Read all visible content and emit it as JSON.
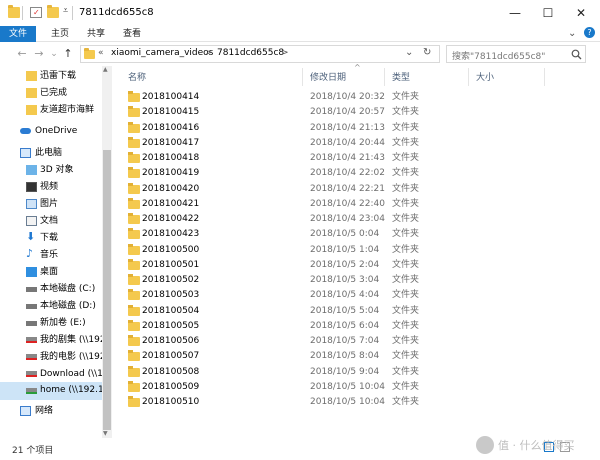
{
  "window": {
    "title": "7811dcd655c8",
    "controls": {
      "minimize": "—",
      "maximize": "☐",
      "close": "✕"
    }
  },
  "ribbon": {
    "tabs": [
      "文件",
      "主页",
      "共享",
      "查看"
    ]
  },
  "nav": {
    "back": "←",
    "forward": "→",
    "recent": "⌄",
    "up": "↑",
    "path": [
      "«",
      "xiaomi_camera_videos",
      ">",
      "7811dcd655c8",
      ">"
    ],
    "path_dropdown": "⌄",
    "refresh": "↻",
    "search_placeholder": "搜索\"7811dcd655c8\"",
    "search_icon": "search-icon"
  },
  "sidebar": {
    "items": [
      {
        "label": "迅雷下载",
        "icon": "folder-icon"
      },
      {
        "label": "已完成",
        "icon": "folder-icon"
      },
      {
        "label": "友道超市海鲜",
        "icon": "folder-icon"
      },
      {
        "label": "OneDrive",
        "icon": "cloud-icon"
      },
      {
        "label": "此电脑",
        "icon": "computer-icon"
      },
      {
        "label": "3D 对象",
        "icon": "3d-objects-icon"
      },
      {
        "label": "视频",
        "icon": "video-icon"
      },
      {
        "label": "图片",
        "icon": "pictures-icon"
      },
      {
        "label": "文档",
        "icon": "documents-icon"
      },
      {
        "label": "下载",
        "icon": "download-icon"
      },
      {
        "label": "音乐",
        "icon": "music-icon"
      },
      {
        "label": "桌面",
        "icon": "desktop-icon"
      },
      {
        "label": "本地磁盘 (C:)",
        "icon": "drive-icon"
      },
      {
        "label": "本地磁盘 (D:)",
        "icon": "drive-icon"
      },
      {
        "label": "新加卷 (E:)",
        "icon": "drive-icon"
      },
      {
        "label": "我的剧集 (\\\\192",
        "icon": "network-drive-disconnected-icon"
      },
      {
        "label": "我的电影 (\\\\192",
        "icon": "network-drive-disconnected-icon"
      },
      {
        "label": "Download (\\\\1",
        "icon": "network-drive-disconnected-icon"
      },
      {
        "label": "home (\\\\192.1",
        "icon": "network-drive-icon"
      },
      {
        "label": "网络",
        "icon": "network-icon"
      }
    ],
    "scroll_up": "▲",
    "scroll_down": "▼"
  },
  "filelist": {
    "columns": [
      "名称",
      "修改日期",
      "类型",
      "大小"
    ],
    "sort_indicator": "^",
    "rows": [
      {
        "name": "2018100414",
        "date": "2018/10/4 20:32",
        "type": "文件夹"
      },
      {
        "name": "2018100415",
        "date": "2018/10/4 20:57",
        "type": "文件夹"
      },
      {
        "name": "2018100416",
        "date": "2018/10/4 21:13",
        "type": "文件夹"
      },
      {
        "name": "2018100417",
        "date": "2018/10/4 20:44",
        "type": "文件夹"
      },
      {
        "name": "2018100418",
        "date": "2018/10/4 21:43",
        "type": "文件夹"
      },
      {
        "name": "2018100419",
        "date": "2018/10/4 22:02",
        "type": "文件夹"
      },
      {
        "name": "2018100420",
        "date": "2018/10/4 22:21",
        "type": "文件夹"
      },
      {
        "name": "2018100421",
        "date": "2018/10/4 22:40",
        "type": "文件夹"
      },
      {
        "name": "2018100422",
        "date": "2018/10/4 23:04",
        "type": "文件夹"
      },
      {
        "name": "2018100423",
        "date": "2018/10/5 0:04",
        "type": "文件夹"
      },
      {
        "name": "2018100500",
        "date": "2018/10/5 1:04",
        "type": "文件夹"
      },
      {
        "name": "2018100501",
        "date": "2018/10/5 2:04",
        "type": "文件夹"
      },
      {
        "name": "2018100502",
        "date": "2018/10/5 3:04",
        "type": "文件夹"
      },
      {
        "name": "2018100503",
        "date": "2018/10/5 4:04",
        "type": "文件夹"
      },
      {
        "name": "2018100504",
        "date": "2018/10/5 5:04",
        "type": "文件夹"
      },
      {
        "name": "2018100505",
        "date": "2018/10/5 6:04",
        "type": "文件夹"
      },
      {
        "name": "2018100506",
        "date": "2018/10/5 7:04",
        "type": "文件夹"
      },
      {
        "name": "2018100507",
        "date": "2018/10/5 8:04",
        "type": "文件夹"
      },
      {
        "name": "2018100508",
        "date": "2018/10/5 9:04",
        "type": "文件夹"
      },
      {
        "name": "2018100509",
        "date": "2018/10/5 10:04",
        "type": "文件夹"
      },
      {
        "name": "2018100510",
        "date": "2018/10/5 10:04",
        "type": "文件夹"
      }
    ]
  },
  "status": {
    "count": "21 个项目"
  },
  "watermark": {
    "text": "值 · 什么值得买"
  },
  "colors": {
    "accent": "#1979ca",
    "folder": "#f4c94e",
    "header_text": "#4c607a"
  }
}
